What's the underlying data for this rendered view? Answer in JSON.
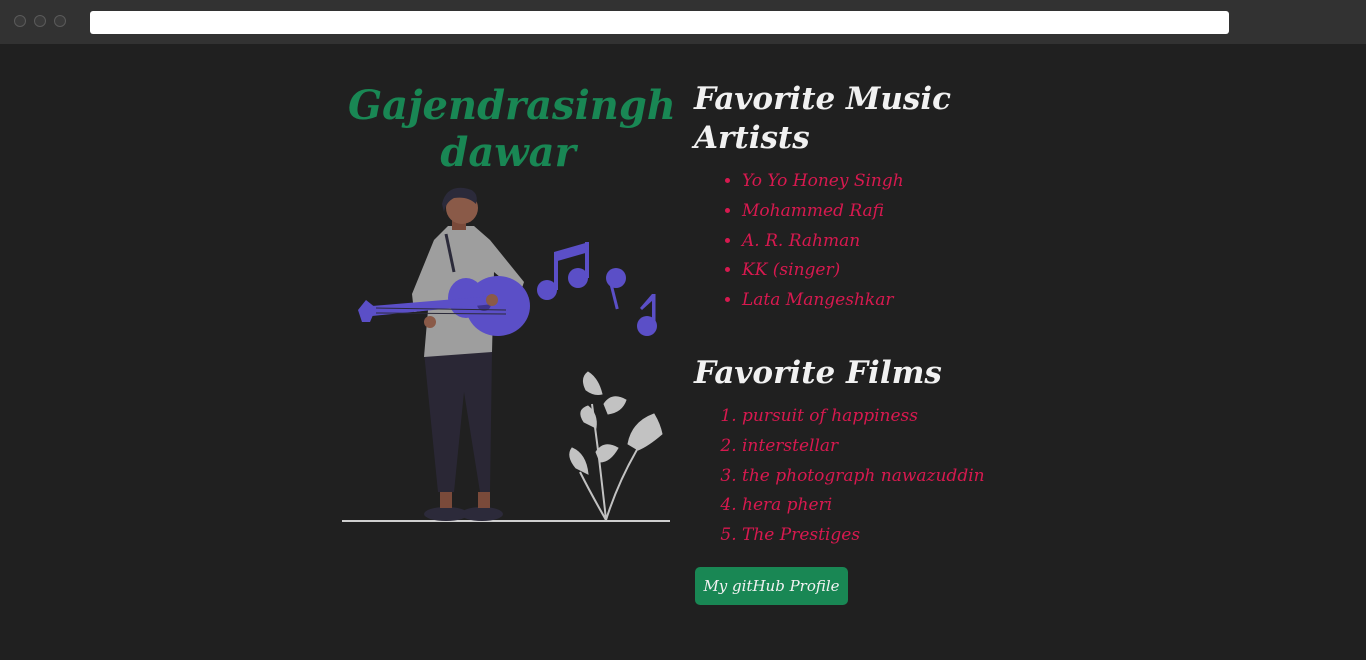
{
  "browser": {
    "window_controls": [
      "close-dot",
      "minimize-dot",
      "maximize-dot"
    ],
    "address": ""
  },
  "profile": {
    "name_line1": "Gajendrasingh",
    "name_line2": "dawar"
  },
  "music": {
    "heading_line1": "Favorite Music",
    "heading_line2": "Artists",
    "artists": [
      "Yo Yo Honey Singh",
      "Mohammed Rafi",
      "A. R. Rahman",
      "KK (singer)",
      "Lata Mangeshkar"
    ]
  },
  "films": {
    "heading": "Favorite Films",
    "items": [
      "pursuit of happiness",
      "interstellar",
      "the photograph nawazuddin",
      "hera pheri",
      "The Prestiges"
    ]
  },
  "github_button": {
    "label": "My gitHub Profile"
  },
  "colors": {
    "background": "#202020",
    "accent_green": "#198754",
    "list_pink": "#d7194f",
    "heading_white": "#f1f1f1",
    "illustration_purple": "#5b4fc7"
  }
}
